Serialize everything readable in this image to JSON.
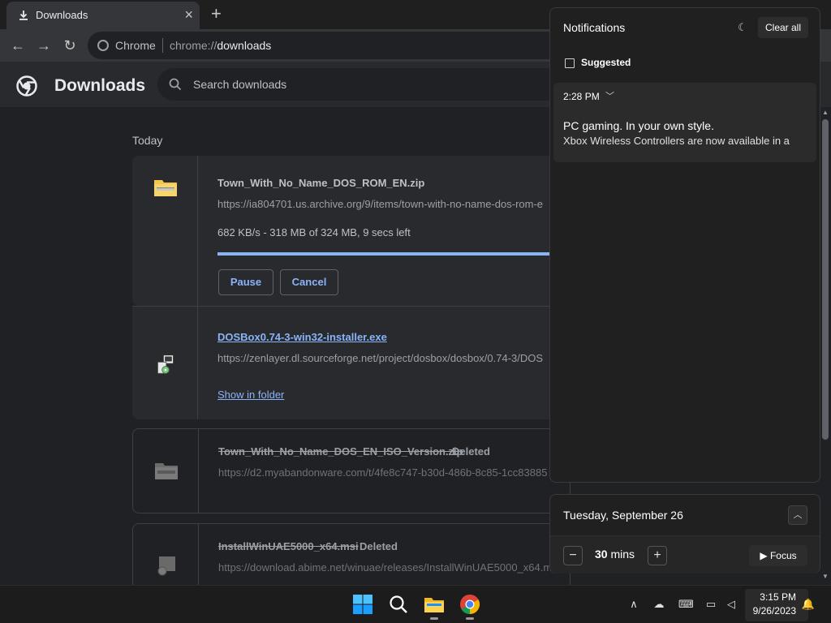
{
  "browser": {
    "tab_title": "Downloads",
    "omnibox_chip": "Chrome",
    "url_prefix": "chrome://",
    "url_host": "downloads"
  },
  "page": {
    "title": "Downloads",
    "search_placeholder": "Search downloads",
    "section_today": "Today"
  },
  "downloads": [
    {
      "name": "Town_With_No_Name_DOS_ROM_EN.zip",
      "url": "https://ia804701.us.archive.org/9/items/town-with-no-name-dos-rom-e",
      "status": "682 KB/s - 318 MB of 324 MB, 9 secs left",
      "progress": 0.98,
      "buttons": [
        "Pause",
        "Cancel"
      ]
    },
    {
      "name": "DOSBox0.74-3-win32-installer.exe",
      "url": "https://zenlayer.dl.sourceforge.net/project/dosbox/dosbox/0.74-3/DOS",
      "link": "Show in folder"
    },
    {
      "name": "Town_With_No_Name_DOS_EN_ISO_Version.zip",
      "tag": "Deleted",
      "url": "https://d2.myabandonware.com/t/4fe8c747-b30d-486b-8c85-1cc83885"
    },
    {
      "name": "InstallWinUAE5000_x64.msi",
      "tag": "Deleted",
      "url": "https://download.abime.net/winuae/releases/InstallWinUAE5000_x64.m"
    }
  ],
  "notifications": {
    "title": "Notifications",
    "clear_all": "Clear all",
    "suggested": "Suggested",
    "card": {
      "time": "2:28 PM",
      "title": "PC gaming. In your own style.",
      "body": "Xbox Wireless Controllers are now available in a"
    }
  },
  "calendar": {
    "date": "Tuesday, September 26",
    "focus_value": "30",
    "focus_unit": "mins",
    "focus_button": "Focus"
  },
  "taskbar": {
    "time": "3:15 PM",
    "date": "9/26/2023"
  },
  "colors": {
    "accent": "#8ab4f8",
    "page_bg": "#202124",
    "card_bg": "#292a2d"
  }
}
